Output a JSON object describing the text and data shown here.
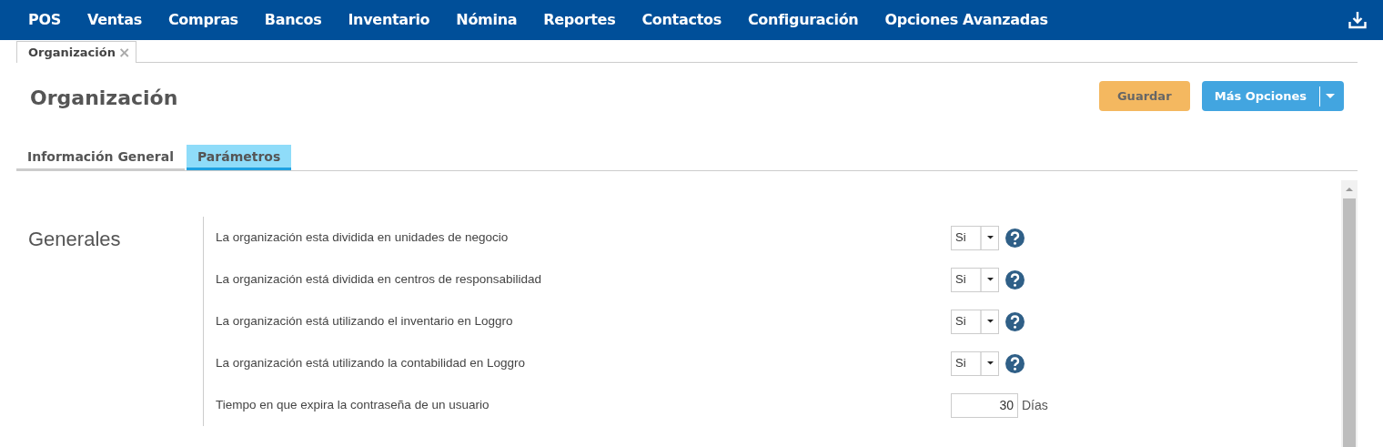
{
  "menu": [
    "POS",
    "Ventas",
    "Compras",
    "Bancos",
    "Inventario",
    "Nómina",
    "Reportes",
    "Contactos",
    "Configuración",
    "Opciones Avanzadas"
  ],
  "doc_tabs": [
    {
      "label": "Organización",
      "close": "×",
      "selected": true
    }
  ],
  "page": {
    "title": "Organización",
    "buttons": [
      {
        "label": "Guardar",
        "kind": "save"
      },
      {
        "label": "Más Opciones",
        "kind": "split"
      }
    ]
  },
  "tabs": [
    {
      "label": "Información General",
      "selected": false
    },
    {
      "label": "Parámetros",
      "selected": true
    }
  ],
  "section": {
    "title": "Generales",
    "rows": [
      {
        "kind": "select",
        "label": "La organización esta dividida en unidades de negocio",
        "value": "Si"
      },
      {
        "kind": "select",
        "label": "La organización está dividida en centros de responsabilidad",
        "value": "Si"
      },
      {
        "kind": "select",
        "label": "La organización está utilizando el inventario en Loggro",
        "value": "Si"
      },
      {
        "kind": "select",
        "label": "La organización está utilizando la contabilidad en Loggro",
        "value": "Si"
      },
      {
        "kind": "number",
        "label": "Tiempo en que expira la contraseña de un usuario",
        "value": "30",
        "unit": "Días"
      }
    ]
  }
}
